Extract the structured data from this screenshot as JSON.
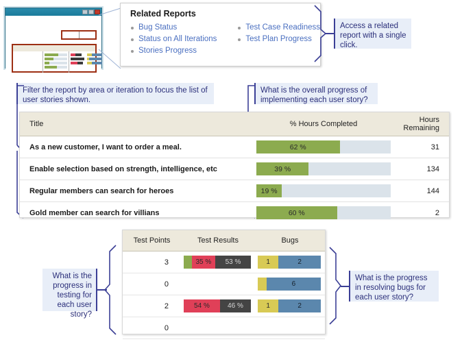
{
  "thumbnail": {
    "name": "report-window-thumbnail",
    "window_buttons": [
      "minimize",
      "maximize",
      "close"
    ]
  },
  "related_reports": {
    "title": "Related Reports",
    "columns": [
      [
        "Bug Status",
        "Status on All Iterations",
        "Stories Progress"
      ],
      [
        "Test Case Readiness",
        "Test Plan Progress"
      ]
    ]
  },
  "callouts": {
    "access": "Access a related report with a single click.",
    "filter": "Filter the report by area or iteration to focus the list of user stories shown.",
    "overall": "What is the overall progress of implementing each user story?",
    "testing": "What is the progress in testing for each user story?",
    "bugs": "What is the progress in resolving bugs for each user story?"
  },
  "report_table": {
    "headers": {
      "title": "Title",
      "pct": "% Hours Completed",
      "hours_line1": "Hours",
      "hours_line2": "Remaining"
    },
    "rows": [
      {
        "title": "As a new customer, I want to order a meal.",
        "pct_label": "62 %",
        "pct": 62,
        "hours_remaining": "31"
      },
      {
        "title": "Enable selection based on strength, intelligence, etc",
        "pct_label": "39 %",
        "pct": 39,
        "hours_remaining": "134"
      },
      {
        "title": "Regular members can search for heroes",
        "pct_label": "19 %",
        "pct": 19,
        "hours_remaining": "144"
      },
      {
        "title": "Gold member can search for villians",
        "pct_label": "60 %",
        "pct": 60,
        "hours_remaining": "2"
      }
    ]
  },
  "test_table": {
    "headers": {
      "test_points": "Test Points",
      "test_results": "Test Results",
      "bugs": "Bugs"
    },
    "rows": [
      {
        "test_points": "3",
        "results": [
          {
            "kind": "green",
            "label": "",
            "pct": 12
          },
          {
            "kind": "red",
            "label": "35 %",
            "pct": 35
          },
          {
            "kind": "dark",
            "label": "53 %",
            "pct": 53
          }
        ],
        "bugs": [
          {
            "kind": "yellow",
            "label": "1",
            "pct": 33
          },
          {
            "kind": "blue",
            "label": "2",
            "pct": 67
          }
        ]
      },
      {
        "test_points": "0",
        "results": [],
        "bugs": [
          {
            "kind": "yellow",
            "label": "",
            "pct": 14
          },
          {
            "kind": "blue",
            "label": "6",
            "pct": 86
          }
        ]
      },
      {
        "test_points": "2",
        "results": [
          {
            "kind": "red",
            "label": "54 %",
            "pct": 54
          },
          {
            "kind": "dark",
            "label": "46 %",
            "pct": 46
          }
        ],
        "bugs": [
          {
            "kind": "yellow",
            "label": "1",
            "pct": 33
          },
          {
            "kind": "blue",
            "label": "2",
            "pct": 67
          }
        ]
      },
      {
        "test_points": "0",
        "results": [],
        "bugs": []
      }
    ]
  },
  "colors": {
    "progress_fill": "#8cab4f",
    "progress_track": "#dbe3ea",
    "header_bg": "#ede9dc",
    "callout_bg": "#e8eef8",
    "callout_text": "#2b2f7a",
    "leader": "#3b3f96",
    "link": "#4a6fc0",
    "bug_active": "#d8ca55",
    "bug_resolved": "#5b87ad",
    "test_failed": "#e04058",
    "test_blocked": "#444444",
    "window_title": "#1b7c9c",
    "highlight_box": "#9d2f13"
  }
}
